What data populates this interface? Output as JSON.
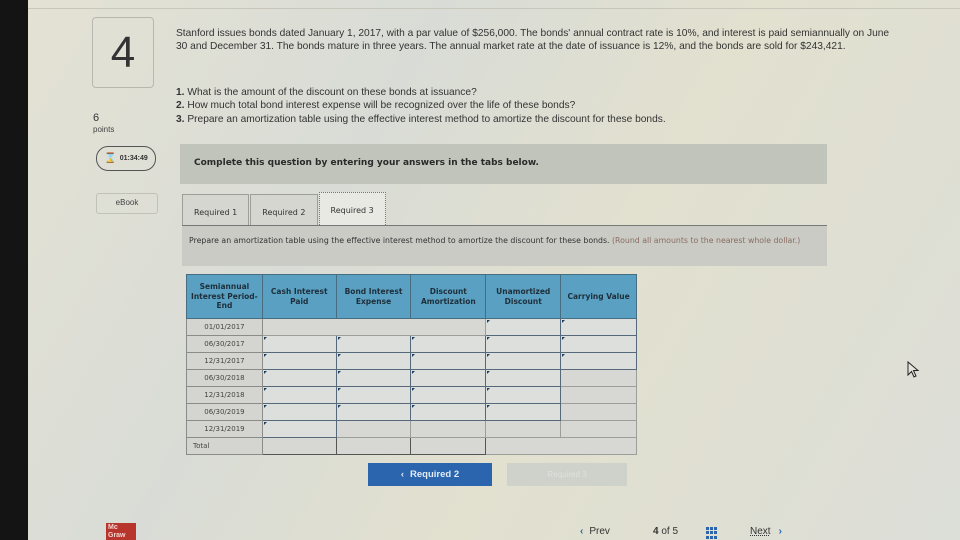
{
  "question": {
    "number": "4",
    "points_value": "6",
    "points_label": "points",
    "timer": "01:34:49",
    "ebook_label": "eBook",
    "problem_text": "Stanford issues bonds dated January 1, 2017, with a par value of $256,000. The bonds' annual contract rate is 10%, and interest is paid semiannually on June 30 and December 31. The bonds mature in three years. The annual market rate at the date of issuance is 12%, and the bonds are sold for $243,421.",
    "requirements": [
      {
        "num": "1.",
        "text": "What is the amount of the discount on these bonds at issuance?"
      },
      {
        "num": "2.",
        "text": "How much total bond interest expense will be recognized over the life of these bonds?"
      },
      {
        "num": "3.",
        "text": "Prepare an amortization table using the effective interest method to amortize the discount for these bonds."
      }
    ]
  },
  "instruction_bar": "Complete this question by entering your answers in the tabs below.",
  "tabs": [
    {
      "label": "Required 1",
      "active": false
    },
    {
      "label": "Required 2",
      "active": false
    },
    {
      "label": "Required 3",
      "active": true
    }
  ],
  "tab_description": {
    "text": "Prepare an amortization table using the effective interest method to amortize the discount for these bonds.",
    "note": "(Round all amounts to the nearest whole dollar.)"
  },
  "table": {
    "headers": [
      "Semiannual Interest Period-End",
      "Cash Interest Paid",
      "Bond Interest Expense",
      "Discount Amortization",
      "Unamortized Discount",
      "Carrying Value"
    ],
    "rows": [
      {
        "period": "01/01/2017",
        "cash_interest_paid": "",
        "bond_interest_expense": "",
        "discount_amortization": "",
        "unamortized_discount": "",
        "carrying_value": ""
      },
      {
        "period": "06/30/2017",
        "cash_interest_paid": "",
        "bond_interest_expense": "",
        "discount_amortization": "",
        "unamortized_discount": "",
        "carrying_value": ""
      },
      {
        "period": "12/31/2017",
        "cash_interest_paid": "",
        "bond_interest_expense": "",
        "discount_amortization": "",
        "unamortized_discount": "",
        "carrying_value": ""
      },
      {
        "period": "06/30/2018",
        "cash_interest_paid": "",
        "bond_interest_expense": "",
        "discount_amortization": "",
        "unamortized_discount": "",
        "carrying_value": ""
      },
      {
        "period": "12/31/2018",
        "cash_interest_paid": "",
        "bond_interest_expense": "",
        "discount_amortization": "",
        "unamortized_discount": "",
        "carrying_value": ""
      },
      {
        "period": "06/30/2019",
        "cash_interest_paid": "",
        "bond_interest_expense": "",
        "discount_amortization": "",
        "unamortized_discount": "",
        "carrying_value": ""
      },
      {
        "period": "12/31/2019",
        "cash_interest_paid": "",
        "bond_interest_expense": "",
        "discount_amortization": "",
        "unamortized_discount": "",
        "carrying_value": ""
      }
    ],
    "total_label": "Total"
  },
  "nav_buttons": {
    "prev_required": "Required 2",
    "next_required": "Required 3"
  },
  "footer": {
    "logo_line1": "Mc",
    "logo_line2": "Graw",
    "prev_label": "Prev",
    "current_page": "4",
    "of_label": "of",
    "total_pages": "5",
    "next_label": "Next"
  },
  "colors": {
    "accent_blue": "#2b65ad",
    "table_header": "#5aa0c2",
    "logo_red": "#b8352d"
  }
}
